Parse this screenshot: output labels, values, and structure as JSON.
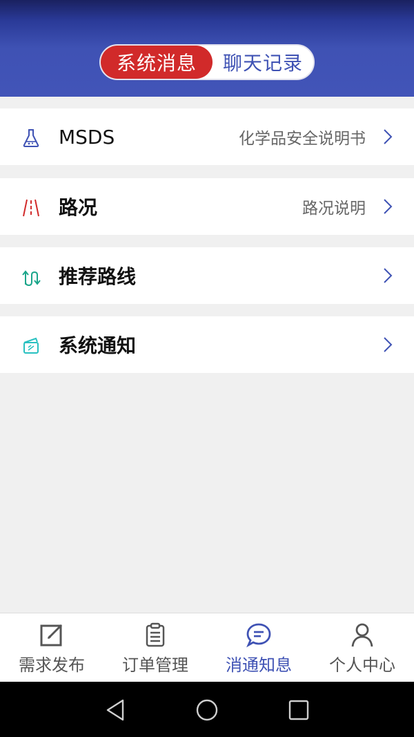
{
  "header": {
    "segments": [
      {
        "label": "系统消息",
        "active": true
      },
      {
        "label": "聊天记录",
        "active": false
      }
    ]
  },
  "list": [
    {
      "title": "MSDS",
      "subtitle": "化学品安全说明书",
      "icon": "flask-icon"
    },
    {
      "title": "路况",
      "subtitle": "路况说明",
      "icon": "road-icon"
    },
    {
      "title": "推荐路线",
      "subtitle": "",
      "icon": "route-arrows-icon"
    },
    {
      "title": "系统通知",
      "subtitle": "",
      "icon": "notice-box-icon"
    }
  ],
  "tabbar": {
    "items": [
      {
        "label": "需求发布",
        "icon": "edit-icon",
        "active": false
      },
      {
        "label": "订单管理",
        "icon": "clipboard-icon",
        "active": false
      },
      {
        "label": "消通知息",
        "icon": "chat-bubble-icon",
        "active": true
      },
      {
        "label": "个人中心",
        "icon": "person-icon",
        "active": false
      }
    ]
  },
  "colors": {
    "header_blue": "#3f52b4",
    "active_red": "#d12a2a",
    "active_tab": "#3f52b4"
  }
}
